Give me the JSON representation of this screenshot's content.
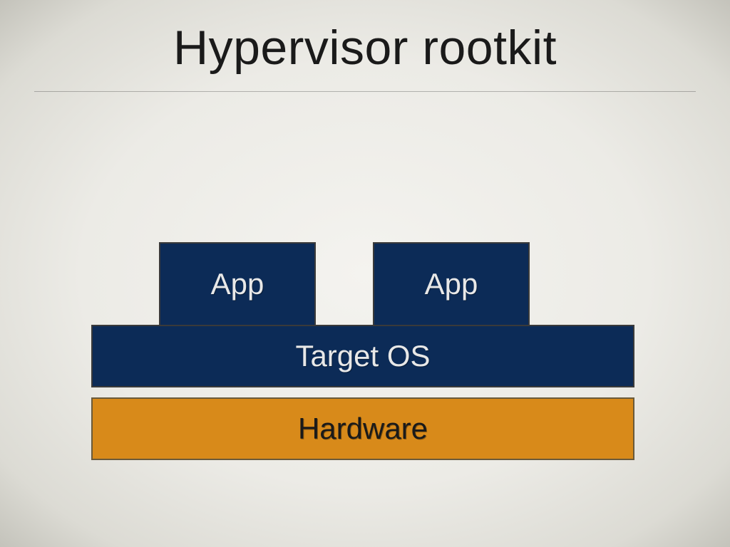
{
  "title": "Hypervisor rootkit",
  "boxes": {
    "app_left": "App",
    "app_right": "App",
    "os": "Target OS",
    "hardware": "Hardware"
  },
  "colors": {
    "app_bg": "#0c2b57",
    "os_bg": "#0c2b57",
    "hw_bg": "#d88a1a"
  }
}
